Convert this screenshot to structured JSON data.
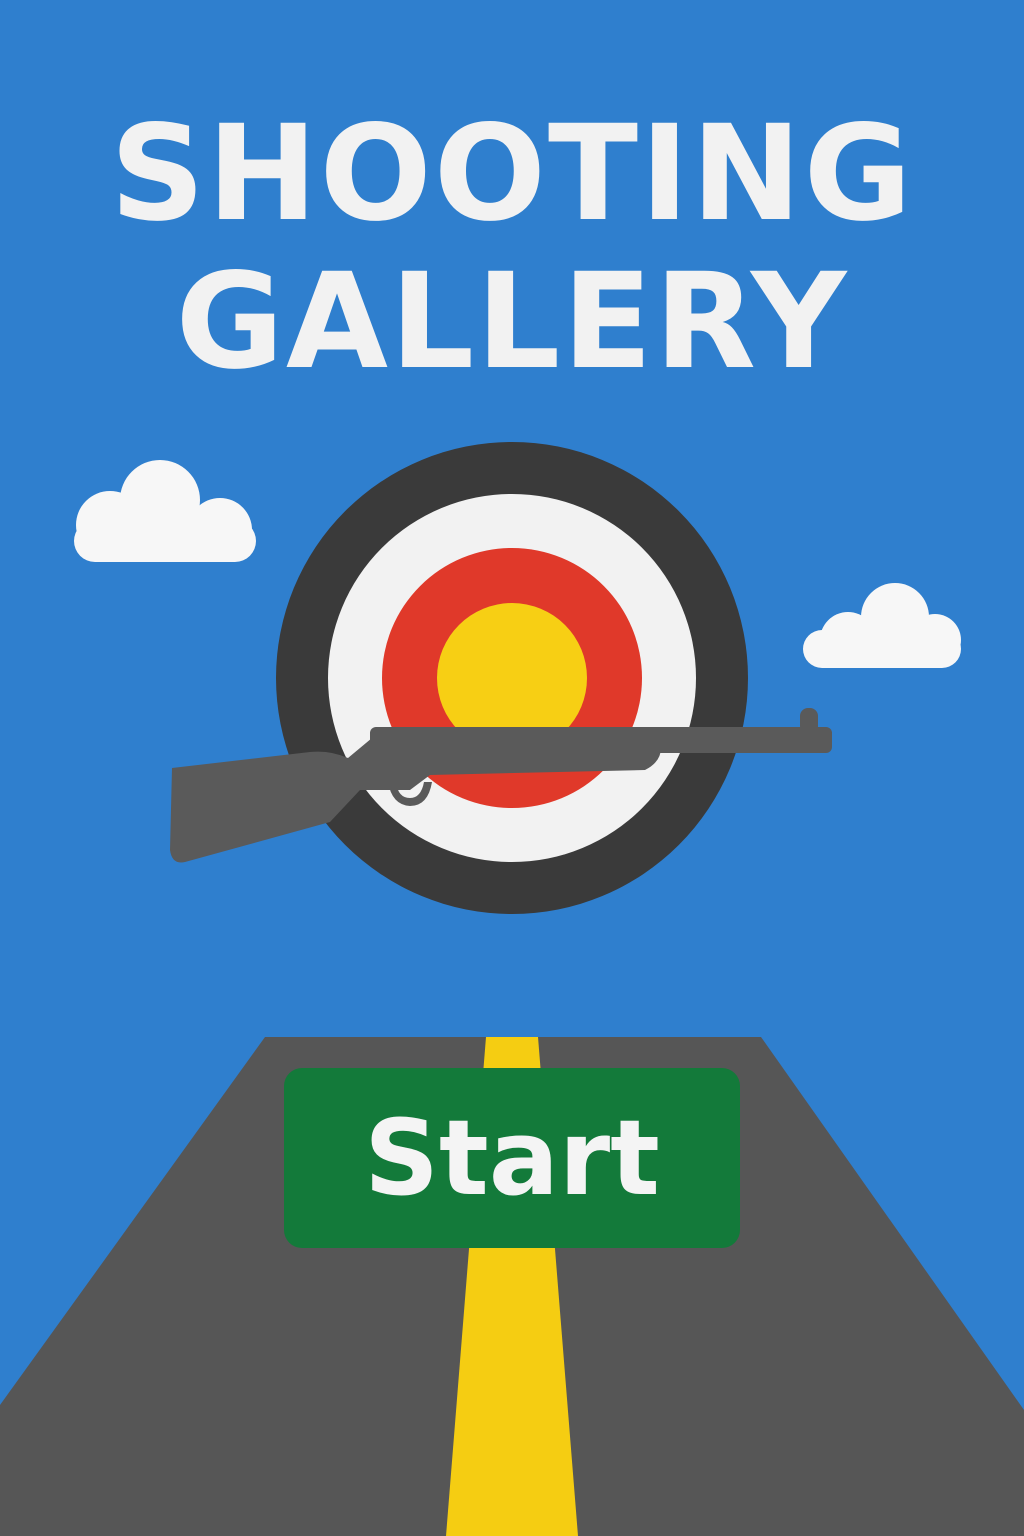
{
  "screen": "title-screen",
  "title": {
    "line1": "SHOOTING",
    "line2": "GALLERY"
  },
  "start_button": {
    "label": "Start"
  },
  "icons": {
    "target": "bullseye-target-icon",
    "rifle": "rifle-icon",
    "clouds": "cloud-icon"
  },
  "colors": {
    "sky": "#2f7fce",
    "title_text": "#f2f2f2",
    "road": "#565656",
    "road_stripe": "#f5cd12",
    "button_bg": "#137a3a",
    "button_text": "#f4f4f4",
    "target_outer": "#3a3a3a",
    "target_white": "#f2f2f2",
    "target_red": "#e0392a",
    "target_yellow": "#f7cf14",
    "rifle": "#5a5a5a",
    "cloud": "#f7f7f7"
  }
}
